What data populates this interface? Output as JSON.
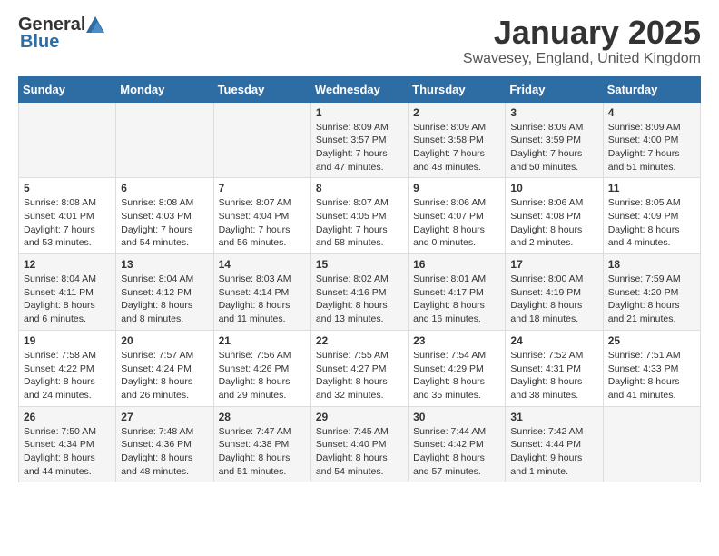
{
  "logo": {
    "general": "General",
    "blue": "Blue"
  },
  "title": "January 2025",
  "subtitle": "Swavesey, England, United Kingdom",
  "weekdays": [
    "Sunday",
    "Monday",
    "Tuesday",
    "Wednesday",
    "Thursday",
    "Friday",
    "Saturday"
  ],
  "weeks": [
    [
      {
        "day": "",
        "info": ""
      },
      {
        "day": "",
        "info": ""
      },
      {
        "day": "",
        "info": ""
      },
      {
        "day": "1",
        "info": "Sunrise: 8:09 AM\nSunset: 3:57 PM\nDaylight: 7 hours and 47 minutes."
      },
      {
        "day": "2",
        "info": "Sunrise: 8:09 AM\nSunset: 3:58 PM\nDaylight: 7 hours and 48 minutes."
      },
      {
        "day": "3",
        "info": "Sunrise: 8:09 AM\nSunset: 3:59 PM\nDaylight: 7 hours and 50 minutes."
      },
      {
        "day": "4",
        "info": "Sunrise: 8:09 AM\nSunset: 4:00 PM\nDaylight: 7 hours and 51 minutes."
      }
    ],
    [
      {
        "day": "5",
        "info": "Sunrise: 8:08 AM\nSunset: 4:01 PM\nDaylight: 7 hours and 53 minutes."
      },
      {
        "day": "6",
        "info": "Sunrise: 8:08 AM\nSunset: 4:03 PM\nDaylight: 7 hours and 54 minutes."
      },
      {
        "day": "7",
        "info": "Sunrise: 8:07 AM\nSunset: 4:04 PM\nDaylight: 7 hours and 56 minutes."
      },
      {
        "day": "8",
        "info": "Sunrise: 8:07 AM\nSunset: 4:05 PM\nDaylight: 7 hours and 58 minutes."
      },
      {
        "day": "9",
        "info": "Sunrise: 8:06 AM\nSunset: 4:07 PM\nDaylight: 8 hours and 0 minutes."
      },
      {
        "day": "10",
        "info": "Sunrise: 8:06 AM\nSunset: 4:08 PM\nDaylight: 8 hours and 2 minutes."
      },
      {
        "day": "11",
        "info": "Sunrise: 8:05 AM\nSunset: 4:09 PM\nDaylight: 8 hours and 4 minutes."
      }
    ],
    [
      {
        "day": "12",
        "info": "Sunrise: 8:04 AM\nSunset: 4:11 PM\nDaylight: 8 hours and 6 minutes."
      },
      {
        "day": "13",
        "info": "Sunrise: 8:04 AM\nSunset: 4:12 PM\nDaylight: 8 hours and 8 minutes."
      },
      {
        "day": "14",
        "info": "Sunrise: 8:03 AM\nSunset: 4:14 PM\nDaylight: 8 hours and 11 minutes."
      },
      {
        "day": "15",
        "info": "Sunrise: 8:02 AM\nSunset: 4:16 PM\nDaylight: 8 hours and 13 minutes."
      },
      {
        "day": "16",
        "info": "Sunrise: 8:01 AM\nSunset: 4:17 PM\nDaylight: 8 hours and 16 minutes."
      },
      {
        "day": "17",
        "info": "Sunrise: 8:00 AM\nSunset: 4:19 PM\nDaylight: 8 hours and 18 minutes."
      },
      {
        "day": "18",
        "info": "Sunrise: 7:59 AM\nSunset: 4:20 PM\nDaylight: 8 hours and 21 minutes."
      }
    ],
    [
      {
        "day": "19",
        "info": "Sunrise: 7:58 AM\nSunset: 4:22 PM\nDaylight: 8 hours and 24 minutes."
      },
      {
        "day": "20",
        "info": "Sunrise: 7:57 AM\nSunset: 4:24 PM\nDaylight: 8 hours and 26 minutes."
      },
      {
        "day": "21",
        "info": "Sunrise: 7:56 AM\nSunset: 4:26 PM\nDaylight: 8 hours and 29 minutes."
      },
      {
        "day": "22",
        "info": "Sunrise: 7:55 AM\nSunset: 4:27 PM\nDaylight: 8 hours and 32 minutes."
      },
      {
        "day": "23",
        "info": "Sunrise: 7:54 AM\nSunset: 4:29 PM\nDaylight: 8 hours and 35 minutes."
      },
      {
        "day": "24",
        "info": "Sunrise: 7:52 AM\nSunset: 4:31 PM\nDaylight: 8 hours and 38 minutes."
      },
      {
        "day": "25",
        "info": "Sunrise: 7:51 AM\nSunset: 4:33 PM\nDaylight: 8 hours and 41 minutes."
      }
    ],
    [
      {
        "day": "26",
        "info": "Sunrise: 7:50 AM\nSunset: 4:34 PM\nDaylight: 8 hours and 44 minutes."
      },
      {
        "day": "27",
        "info": "Sunrise: 7:48 AM\nSunset: 4:36 PM\nDaylight: 8 hours and 48 minutes."
      },
      {
        "day": "28",
        "info": "Sunrise: 7:47 AM\nSunset: 4:38 PM\nDaylight: 8 hours and 51 minutes."
      },
      {
        "day": "29",
        "info": "Sunrise: 7:45 AM\nSunset: 4:40 PM\nDaylight: 8 hours and 54 minutes."
      },
      {
        "day": "30",
        "info": "Sunrise: 7:44 AM\nSunset: 4:42 PM\nDaylight: 8 hours and 57 minutes."
      },
      {
        "day": "31",
        "info": "Sunrise: 7:42 AM\nSunset: 4:44 PM\nDaylight: 9 hours and 1 minute."
      },
      {
        "day": "",
        "info": ""
      }
    ]
  ]
}
